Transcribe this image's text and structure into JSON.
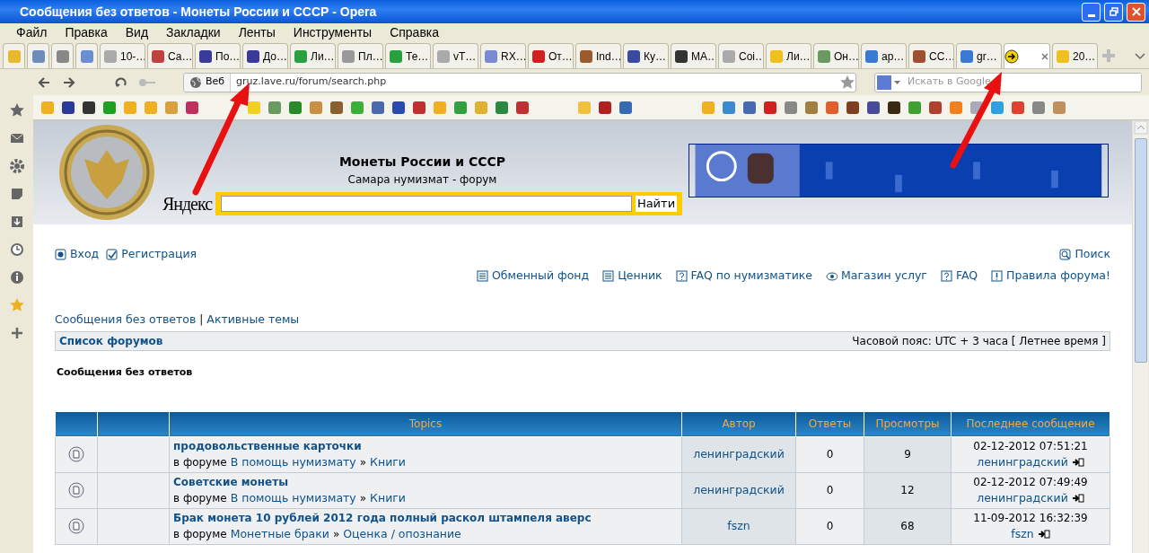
{
  "window": {
    "title": "Сообщения без ответов - Монеты России и СССР - Opera"
  },
  "menu": [
    "Файл",
    "Правка",
    "Вид",
    "Закладки",
    "Ленты",
    "Инструменты",
    "Справка"
  ],
  "tabs": [
    {
      "selected": false
    },
    {
      "selected": false
    },
    {
      "selected": false
    },
    {
      "selected": false
    },
    {
      "label": "10-…",
      "selected": false
    },
    {
      "label": "Са…",
      "selected": false
    },
    {
      "label": "По…",
      "selected": false
    },
    {
      "label": "До…",
      "selected": false
    },
    {
      "label": "Ли…",
      "selected": false
    },
    {
      "label": "Пл…",
      "selected": false
    },
    {
      "label": "Те…",
      "selected": false
    },
    {
      "label": "vT…",
      "selected": false
    },
    {
      "label": "RX…",
      "selected": false
    },
    {
      "label": "От…",
      "selected": false
    },
    {
      "label": "Ind…",
      "selected": false
    },
    {
      "label": "Ку…",
      "selected": false
    },
    {
      "label": "MA…",
      "selected": false
    },
    {
      "label": "Coi…",
      "selected": false
    },
    {
      "label": "Ли…",
      "selected": false
    },
    {
      "label": "Он…",
      "selected": false
    },
    {
      "label": "ар…",
      "selected": false
    },
    {
      "label": "СС…",
      "selected": false
    },
    {
      "label": "gr…",
      "selected": false
    },
    {
      "selected": true
    },
    {
      "label": "20…",
      "selected": false
    }
  ],
  "address_bar": {
    "mode": "Веб",
    "url": "gruz.lave.ru/forum/search.php"
  },
  "search": {
    "placeholder": "Искать в Google"
  },
  "header": {
    "title": "Монеты России и СССР",
    "subtitle": "Самара нумизмат - форум",
    "yandex": "Яндекс",
    "search_button": "Найти"
  },
  "user_links": [
    "Вход",
    "Регистрация"
  ],
  "search_link": "Поиск",
  "nav_links": [
    "Обменный фонд",
    "Ценник",
    "FAQ по нумизматике",
    "Магазин услуг",
    "FAQ",
    "Правила форума!"
  ],
  "quick_links": {
    "items": [
      "Сообщения без ответов",
      "Активные темы"
    ],
    "separator": "|"
  },
  "breadcrumb": {
    "forum_list": "Список форумов",
    "timezone": "Часовой пояс: UTC + 3 часа [ Летнее время ]"
  },
  "heading": "Сообщения без ответов",
  "table": {
    "columns": [
      "Topics",
      "Автор",
      "Ответы",
      "Просмотры",
      "Последнее сообщение"
    ],
    "rows": [
      {
        "title": "продовольственные карточки",
        "location": [
          {
            "kind": "label",
            "text": "в форуме"
          },
          {
            "kind": "link",
            "text": "В помощь нумизмату"
          },
          {
            "kind": "separator",
            "text": "»"
          },
          {
            "kind": "link",
            "text": "Книги"
          }
        ],
        "author": "ленинградский",
        "replies": "0",
        "views": "9",
        "last_time": "02-12-2012 07:51:21",
        "last_author": "ленинградский"
      },
      {
        "title": "Советские монеты",
        "location": [
          {
            "kind": "label",
            "text": "в форуме"
          },
          {
            "kind": "link",
            "text": "В помощь нумизмату"
          },
          {
            "kind": "separator",
            "text": "»"
          },
          {
            "kind": "link",
            "text": "Книги"
          }
        ],
        "author": "ленинградский",
        "replies": "0",
        "views": "12",
        "last_time": "02-12-2012 07:49:49",
        "last_author": "ленинградский"
      },
      {
        "title": "Брак монета 10 рублей 2012 года полный раскол штампеля аверс",
        "location": [
          {
            "kind": "label",
            "text": "в форуме"
          },
          {
            "kind": "link",
            "text": "Монетные браки"
          },
          {
            "kind": "separator",
            "text": "»"
          },
          {
            "kind": "link",
            "text": "Оценка / опознание"
          }
        ],
        "author": "fszn",
        "replies": "0",
        "views": "68",
        "last_time": "11-09-2012 16:32:39",
        "last_author": "fszn"
      }
    ]
  }
}
